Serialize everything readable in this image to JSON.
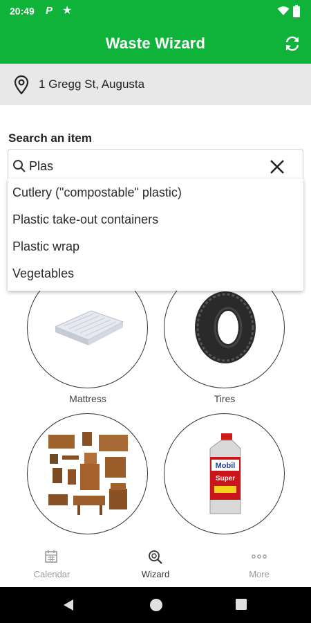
{
  "status_bar": {
    "time": "20:49",
    "p_icon": "P"
  },
  "app_bar": {
    "title": "Waste Wizard",
    "refresh_icon": "refresh-icon"
  },
  "location": {
    "icon": "location-pin-icon",
    "address": "1 Gregg St, Augusta"
  },
  "search": {
    "label": "Search an item",
    "value": "Plas",
    "suggestions": [
      "Cutlery (\"compostable\" plastic)",
      "Plastic take-out containers",
      "Plastic wrap",
      "Vegetables"
    ]
  },
  "tiles": [
    {
      "label": "Mattress",
      "icon": "mattress-image"
    },
    {
      "label": "Tires",
      "icon": "tire-image"
    },
    {
      "label": "",
      "icon": "furniture-image"
    },
    {
      "label": "",
      "icon": "motor-oil-image"
    }
  ],
  "oil_bottle": {
    "brand": "Mobil",
    "product": "Super"
  },
  "bottom_nav": [
    {
      "label": "Calendar",
      "icon": "calendar-icon"
    },
    {
      "label": "Wizard",
      "icon": "wizard-search-icon",
      "active": true
    },
    {
      "label": "More",
      "icon": "more-icon"
    }
  ],
  "colors": {
    "primary": "#10b33a",
    "location_bar": "#e8e8e8"
  }
}
